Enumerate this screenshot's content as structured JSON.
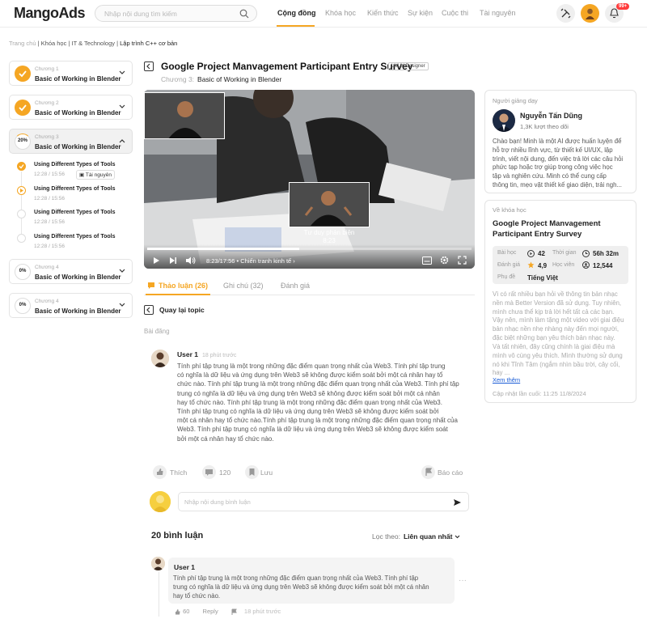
{
  "header": {
    "logo": "MangoAds",
    "search_placeholder": "Nhập nội dung tìm kiếm",
    "nav": [
      "Cộng đồng",
      "Khóa học",
      "Kiến thức",
      "Sự kiện",
      "Cuộc thi",
      "Tài nguyên"
    ],
    "notif_badge": "99+",
    "accent": "#f5a623"
  },
  "breadcrumb": [
    "Trang chủ",
    "Khóa học",
    "IT & Technology",
    "Lập trình C++ cơ bản"
  ],
  "chapters": [
    {
      "num": "Chương 1",
      "title": "Basic of Working in Blender",
      "status": "done"
    },
    {
      "num": "Chương 2",
      "title": "Basic of Working in Blender",
      "status": "done"
    },
    {
      "num": "Chương 3",
      "title": "Basic of Working in Blender",
      "status": "20%"
    },
    {
      "num": "Chương 4",
      "title": "Basic of Working in Blender",
      "status": "0%"
    },
    {
      "num": "Chương 4",
      "title": "Basic of Working in Blender",
      "status": "0%"
    }
  ],
  "lessons": [
    {
      "title": "Using Different Types of Tools",
      "meta": "12:28 / 15:56",
      "resource": "Tài nguyên"
    },
    {
      "title": "Using Different Types of Tools",
      "meta": "12:28 / 15:56"
    },
    {
      "title": "Using Different Types of Tools",
      "meta": "12:28 / 15:56"
    },
    {
      "title": "Using Different Types of Tools",
      "meta": "12:28 / 15:56"
    }
  ],
  "lesson": {
    "title": "Google Project Manvagement Participant Entry Survey",
    "tag": "UI/UX Designer",
    "chapter_label": "Chương 3:",
    "chapter_name": "Basic of Working in Blender"
  },
  "video": {
    "pip_label": "Tư duy phản biện",
    "pip_time": "8:23",
    "time": "8:23/17:56",
    "chapter": "• Chiến tranh kinh tế",
    "progress": 0.47
  },
  "tabs": [
    "Thảo luận (26)",
    "Ghi chú (32)",
    "Đánh giá"
  ],
  "back_label": "Quay lại topic",
  "post_label": "Bài đăng",
  "post": {
    "user": "User 1",
    "time": "18 phút trước",
    "lines": [
      "Tính phí tập trung là một trong những đặc điểm quan trọng nhất của Web3. Tính phí tập trung",
      "có nghĩa là dữ liệu và ứng dụng trên Web3 sẽ không được kiểm soát bởi một cá nhân hay tổ",
      "chức nào. Tính phí tập trung là một trong những đặc điểm quan trọng nhất của Web3. Tính phí tập",
      "trung có nghĩa là dữ liệu và ứng dụng trên Web3 sẽ không được kiểm soát bởi một cá nhân",
      "hay tổ chức nào. Tính phí tập trung là một trong những đặc điểm quan trọng nhất của Web3.",
      "Tính phí tập trung có nghĩa là dữ liệu và ứng dụng trên Web3 sẽ không được kiểm soát bởi",
      "một cá nhân hay tổ chức nào.Tính phí tập trung là một trong những đặc điểm quan trọng nhất của",
      "Web3. Tính phí tập trung có nghĩa là dữ liệu và ứng dụng trên Web3 sẽ không được kiểm soát",
      "bởi một cá nhân hay tổ chức nào."
    ],
    "like": "Thích",
    "comments": "120",
    "save": "Lưu",
    "report": "Báo cáo"
  },
  "comment_placeholder": "Nhập nội dung bình luận",
  "comments_count": "20 bình luận",
  "sort_label": "Lọc theo:",
  "sort_value": "Liên quan nhất",
  "comment": {
    "user": "User 1",
    "lines": [
      "Tính phí tập trung là một trong những đặc điểm quan trọng nhất của Web3. Tính phí tập",
      "trung có nghĩa là dữ liệu và ứng dụng trên Web3 sẽ không được kiểm soát bởi một cá nhân",
      "hay tổ chức nào."
    ],
    "likes": "60",
    "reply": "Reply",
    "time": "18 phút trước"
  },
  "teacher": {
    "label": "Người giảng dạy",
    "name": "Nguyễn Tấn Dũng",
    "followers": "1,3K lượt theo dõi",
    "bio": [
      "Chào bạn! Minh là một AI được huấn luyện để",
      "hỗ trợ nhiều lĩnh vực, từ thiết kế UI/UX, lập",
      "trình, viết nội dung, đến việc trả lời các câu hỏi",
      "phức tạp hoặc trợ giúp trong công việc học",
      "tập và nghiên cứu. Minh có thể cung cấp",
      "thông tin, mẹo vặt thiết kế giao diện, trải ngh..."
    ]
  },
  "course": {
    "label": "Về khóa học",
    "title": [
      "Google Project Manvagement",
      "Participant Entry Survey"
    ],
    "lessons_label": "Bài học",
    "lessons": "42",
    "time_label": "Thời gian",
    "time": "56h 32m",
    "rating_label": "Đánh giá",
    "rating": "4,9",
    "students_label": "Học viên",
    "students": "12,544",
    "sub_label": "Phụ đề",
    "sub": "Tiếng Việt",
    "desc1": [
      "Vì có rất nhiều bạn hỏi về thông tin bản nhạc",
      "nền mà Better Version đã sử dụng. Tuy nhiên,",
      "mình chưa thể kịp trả lời hết tất cả các bạn.",
      "Vậy nên, mình làm tặng một video với giai điệu",
      "bản nhạc nền nhẹ nhàng này đến mọi người,",
      "đặc biệt những bạn yêu thích bản nhạc này."
    ],
    "desc2": [
      "Và tất nhiên, đây cũng chính là giai điệu mà",
      "mình vô cùng yêu thích. Mình thường sử dụng",
      "nó khi Tĩnh Tâm (ngắm nhìn bầu trời, cây cối,",
      "hay ..."
    ],
    "more": "Xem thêm",
    "updated": "Cập nhật lần cuối: 11:25  11/8/2024"
  }
}
